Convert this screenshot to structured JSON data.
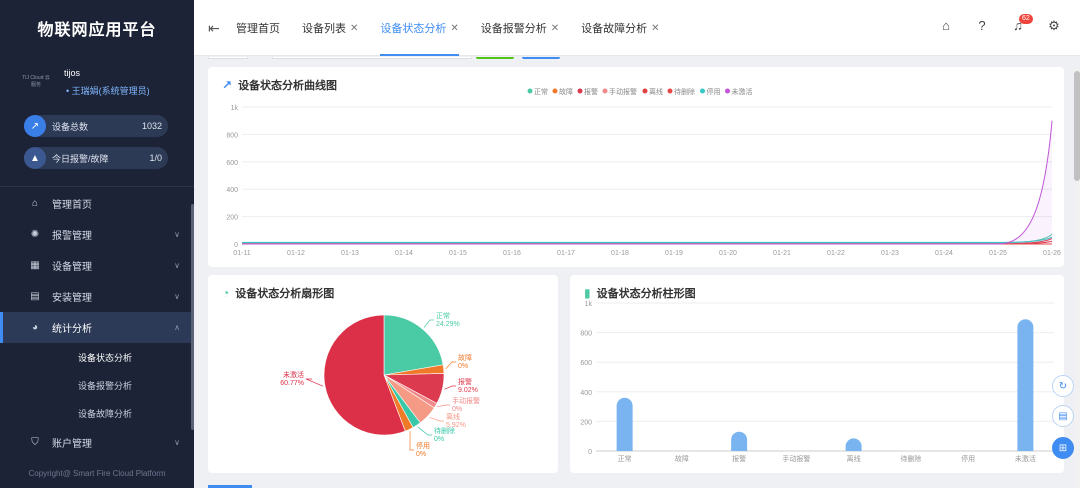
{
  "app": {
    "title": "物联网应用平台",
    "copyright": "Copyright@ Smart Fire Cloud Platform",
    "logo_text": "TIJ Cloud 云服务"
  },
  "user": {
    "name": "tijos",
    "role": "王瑞娟(系统管理员)"
  },
  "stats": [
    {
      "label": "设备总数",
      "value": "1032",
      "icon": "trend-icon"
    },
    {
      "label": "今日报警/故障",
      "value": "1/0",
      "icon": "alarm-icon"
    }
  ],
  "menu": [
    {
      "label": "管理首页",
      "icon": "home-icon",
      "chevron": false
    },
    {
      "label": "报警管理",
      "icon": "alarm-light-icon",
      "chevron": true
    },
    {
      "label": "设备管理",
      "icon": "device-icon",
      "chevron": true
    },
    {
      "label": "安装管理",
      "icon": "install-icon",
      "chevron": true
    },
    {
      "label": "统计分析",
      "icon": "pie-icon",
      "chevron": true,
      "active": true
    },
    {
      "label": "账户管理",
      "icon": "shield-icon",
      "chevron": true
    }
  ],
  "submenu": [
    "设备状态分析",
    "设备报警分析",
    "设备故障分析"
  ],
  "tabs": [
    {
      "label": "管理首页",
      "closable": false
    },
    {
      "label": "设备列表",
      "closable": true
    },
    {
      "label": "设备状态分析",
      "closable": true,
      "active": true
    },
    {
      "label": "设备报警分析",
      "closable": true
    },
    {
      "label": "设备故障分析",
      "closable": true
    }
  ],
  "notifications": {
    "count": "62"
  },
  "colors": {
    "accent": "#3f8cf2",
    "normal": "#4bcba5",
    "fault": "#f07a2a",
    "alarm": "#dc3a4e",
    "manual_alarm": "#f08a8a",
    "offline": "#e04040",
    "pending_delete": "#e84848",
    "disabled": "#38c8c8",
    "inactive": "#c055d8",
    "bar": "#7ab4f0"
  },
  "line_chart": {
    "title": "设备状态分析曲线图"
  },
  "pie_chart": {
    "title": "设备状态分析扇形图"
  },
  "bar_chart": {
    "title": "设备状态分析柱形图"
  },
  "chart_data": [
    {
      "type": "line",
      "title": "设备状态分析曲线图",
      "x": [
        "01-11",
        "01-12",
        "01-13",
        "01-14",
        "01-15",
        "01-16",
        "01-17",
        "01-18",
        "01-19",
        "01-20",
        "01-21",
        "01-22",
        "01-23",
        "01-24",
        "01-25",
        "01-26"
      ],
      "yticks": [
        "0",
        "200",
        "400",
        "600",
        "800",
        "1k"
      ],
      "ylim": [
        0,
        1000
      ],
      "grid": true,
      "legend": "top-center",
      "series": [
        {
          "name": "正常",
          "color": "#4bcba5",
          "values": [
            8,
            8,
            8,
            8,
            8,
            8,
            8,
            8,
            8,
            8,
            8,
            8,
            8,
            8,
            8,
            70
          ]
        },
        {
          "name": "故障",
          "color": "#f07a2a",
          "values": [
            0,
            0,
            0,
            0,
            0,
            0,
            0,
            0,
            0,
            0,
            0,
            0,
            0,
            0,
            0,
            0
          ]
        },
        {
          "name": "报警",
          "color": "#dc3a4e",
          "values": [
            2,
            2,
            2,
            2,
            2,
            2,
            2,
            2,
            2,
            2,
            2,
            2,
            2,
            2,
            2,
            40
          ]
        },
        {
          "name": "手动报警",
          "color": "#f08a8a",
          "values": [
            0,
            0,
            0,
            0,
            0,
            0,
            0,
            0,
            0,
            0,
            0,
            0,
            0,
            0,
            0,
            0
          ]
        },
        {
          "name": "离线",
          "color": "#e04040",
          "values": [
            0,
            0,
            0,
            0,
            0,
            0,
            0,
            0,
            0,
            0,
            0,
            0,
            0,
            0,
            0,
            20
          ]
        },
        {
          "name": "待删除",
          "color": "#e84848",
          "values": [
            0,
            0,
            0,
            0,
            0,
            0,
            0,
            0,
            0,
            0,
            0,
            0,
            0,
            0,
            0,
            0
          ]
        },
        {
          "name": "停用",
          "color": "#38c8c8",
          "values": [
            12,
            12,
            12,
            12,
            12,
            12,
            12,
            12,
            12,
            12,
            12,
            12,
            12,
            12,
            12,
            50
          ]
        },
        {
          "name": "未激活",
          "color": "#c055d8",
          "values": [
            0,
            0,
            0,
            0,
            0,
            0,
            0,
            0,
            0,
            0,
            0,
            0,
            0,
            0,
            0,
            900
          ]
        }
      ]
    },
    {
      "type": "pie",
      "title": "设备状态分析扇形图",
      "slices": [
        {
          "name": "正常",
          "percent": "24.29%",
          "value": 24.29,
          "color": "#4bcba5"
        },
        {
          "name": "故障",
          "percent": "0%",
          "value": 2.5,
          "color": "#f07a2a"
        },
        {
          "name": "报警",
          "percent": "9.02%",
          "value": 9.02,
          "color": "#dc3a4e"
        },
        {
          "name": "手动报警",
          "percent": "0%",
          "value": 1.5,
          "color": "#f08a8a"
        },
        {
          "name": "离线",
          "percent": "5.92%",
          "value": 5.92,
          "color": "#f59a85"
        },
        {
          "name": "待删除",
          "percent": "0%",
          "value": 2.5,
          "color": "#38c8a8"
        },
        {
          "name": "停用",
          "percent": "0%",
          "value": 2.5,
          "color": "#f07a2a"
        },
        {
          "name": "未激活",
          "percent": "60.77%",
          "value": 60.77,
          "color": "#dc2f48"
        }
      ]
    },
    {
      "type": "bar",
      "title": "设备状态分析柱形图",
      "categories": [
        "正常",
        "故障",
        "报警",
        "手动报警",
        "离线",
        "待删除",
        "停用",
        "未激活"
      ],
      "values": [
        360,
        0,
        130,
        0,
        85,
        0,
        0,
        890
      ],
      "yticks": [
        "0",
        "200",
        "400",
        "600",
        "800",
        "1k"
      ],
      "ylim": [
        0,
        1000
      ],
      "grid": true
    }
  ]
}
